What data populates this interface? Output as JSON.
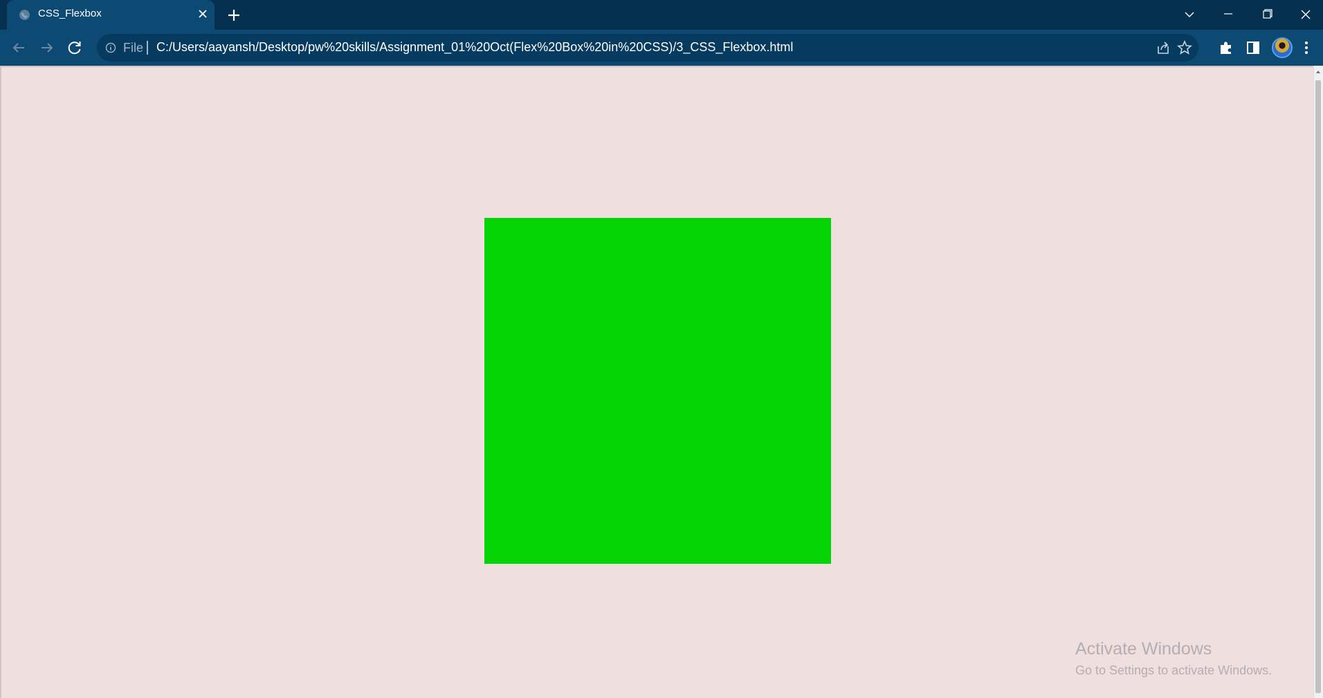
{
  "browser": {
    "tab": {
      "title": "CSS_Flexbox"
    },
    "address_bar": {
      "scheme_label": "File",
      "url": "C:/Users/aayansh/Desktop/pw%20skills/Assignment_01%20Oct(Flex%20Box%20in%20CSS)/3_CSS_Flexbox.html"
    }
  },
  "page": {
    "background_color": "#f0dfdf",
    "box_color": "#04d404"
  },
  "watermark": {
    "line1": "Activate Windows",
    "line2": "Go to Settings to activate Windows."
  },
  "icons": {
    "favicon": "globe-icon",
    "tab_close": "close-icon",
    "new_tab": "plus-icon",
    "back": "arrow-left-icon",
    "forward": "arrow-right-icon",
    "reload": "reload-icon",
    "site_info": "info-icon",
    "share": "share-icon",
    "bookmark": "star-icon",
    "extensions": "puzzle-icon",
    "side_panel": "side-panel-icon",
    "menu": "kebab-menu-icon"
  }
}
